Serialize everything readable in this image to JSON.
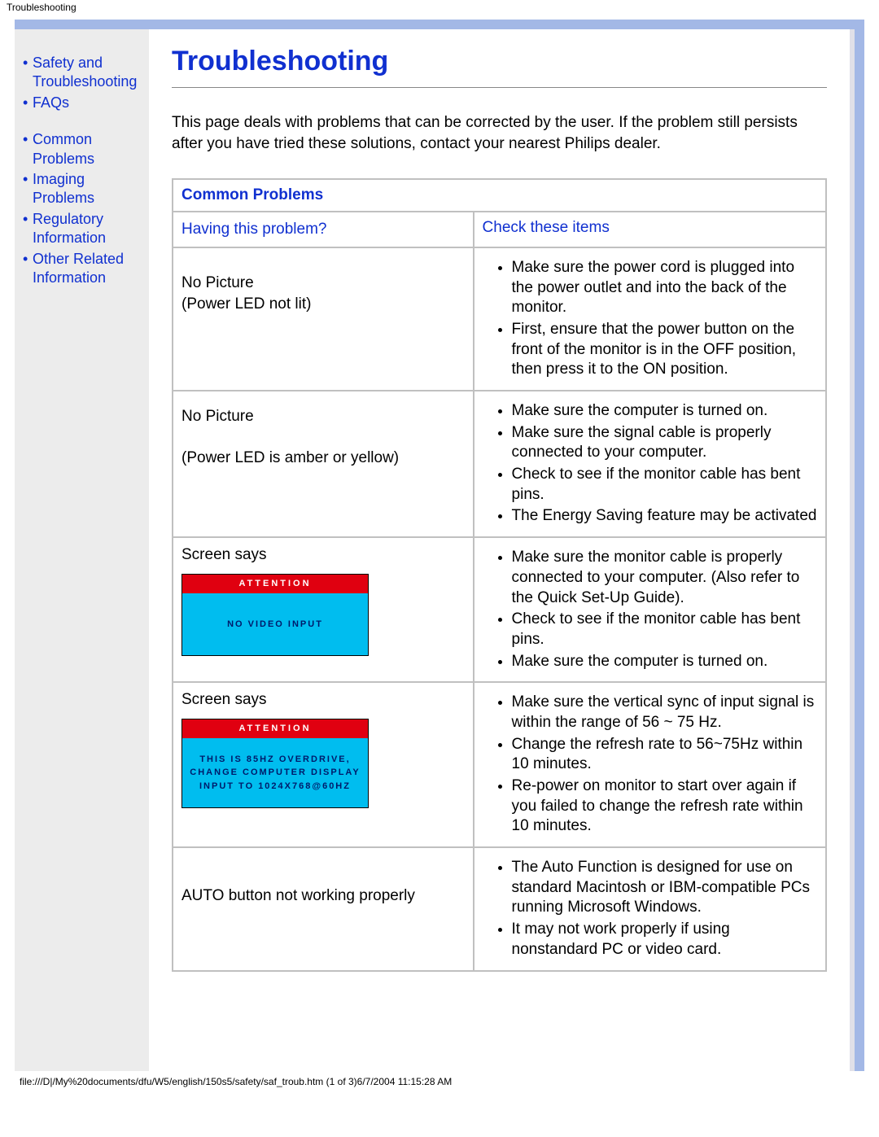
{
  "header_tab": "Troubleshooting",
  "page_title": "Troubleshooting",
  "intro": "This page deals with problems that can be corrected by the user. If the problem still persists after you have tried these solutions, contact your nearest Philips dealer.",
  "nav_group1": [
    "Safety and Troubleshooting",
    "FAQs"
  ],
  "nav_group2": [
    "Common Problems",
    "Imaging Problems",
    "Regulatory Information",
    "Other Related Information"
  ],
  "section_title": "Common Problems",
  "col1_header": "Having this problem?",
  "col2_header": "Check these items",
  "rows": [
    {
      "problem_line1": "No Picture",
      "problem_line2": "(Power LED not lit)",
      "checks": [
        "Make sure the power cord is plugged into the power outlet and into the back of the monitor.",
        "First, ensure that the power button on the front of the monitor is in the OFF position, then press it to the ON position."
      ]
    },
    {
      "problem_line1": "No Picture",
      "problem_line2": "(Power LED is amber or yellow)",
      "checks": [
        "Make sure the computer is turned on.",
        "Make sure the signal cable is properly connected to your computer.",
        "Check to see if the monitor cable has bent pins.",
        "The Energy Saving feature may be activated"
      ]
    },
    {
      "problem_line1": "Screen says",
      "osd": {
        "title": "ATTENTION",
        "body": [
          "NO VIDEO INPUT"
        ]
      },
      "checks": [
        "Make sure the monitor cable is properly connected to your computer. (Also refer to the Quick Set-Up Guide).",
        "Check to see if the monitor cable has bent pins.",
        "Make sure the computer is turned on."
      ]
    },
    {
      "problem_line1": "Screen says",
      "osd": {
        "title": "ATTENTION",
        "body": [
          "THIS IS 85HZ OVERDRIVE,",
          "CHANGE COMPUTER DISPLAY",
          "INPUT TO 1024X768@60HZ"
        ]
      },
      "checks": [
        "Make sure the vertical sync of input signal is within the range of 56 ~ 75 Hz.",
        "Change the refresh rate to 56~75Hz within 10 minutes.",
        "Re-power on monitor to start over again if you failed to change the refresh rate within 10 minutes."
      ]
    },
    {
      "problem_line1": "AUTO button not working properly",
      "checks": [
        "The Auto Function is designed for use on standard Macintosh or IBM-compatible PCs running Microsoft Windows.",
        "It may not work properly if using nonstandard PC or video card."
      ]
    }
  ],
  "footer": "file:///D|/My%20documents/dfu/W5/english/150s5/safety/saf_troub.htm (1 of 3)6/7/2004 11:15:28 AM"
}
